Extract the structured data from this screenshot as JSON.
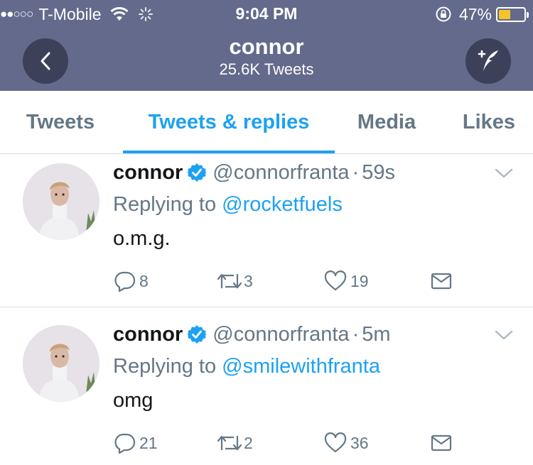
{
  "status_bar": {
    "signal": "●●○○○",
    "carrier": "T-Mobile",
    "time": "9:04 PM",
    "battery_percent": "47%",
    "battery_level": 0.47,
    "battery_color": "#f5c42a"
  },
  "header": {
    "title": "connor",
    "subtitle": "25.6K Tweets",
    "back_icon": "chevron-left-icon",
    "compose_icon": "compose-tweet-icon",
    "background": "#646a8c"
  },
  "tabs": [
    {
      "label": "Tweets",
      "active": false
    },
    {
      "label": "Tweets & replies",
      "active": true
    },
    {
      "label": "Media",
      "active": false
    },
    {
      "label": "Likes",
      "active": false
    }
  ],
  "accent": "#1da1f2",
  "tweets": [
    {
      "name": "connor",
      "handle": "@connorfranta",
      "dot": "·",
      "time": "59s",
      "replying_prefix": "Replying to",
      "replying_to": "@rocketfuels",
      "text": "o.m.g.",
      "replies": "8",
      "retweets": "3",
      "likes": "19"
    },
    {
      "name": "connor",
      "handle": "@connorfranta",
      "dot": "·",
      "time": "5m",
      "replying_prefix": "Replying to",
      "replying_to": "@smilewithfranta",
      "text": "omg",
      "replies": "21",
      "retweets": "2",
      "likes": "36"
    }
  ]
}
